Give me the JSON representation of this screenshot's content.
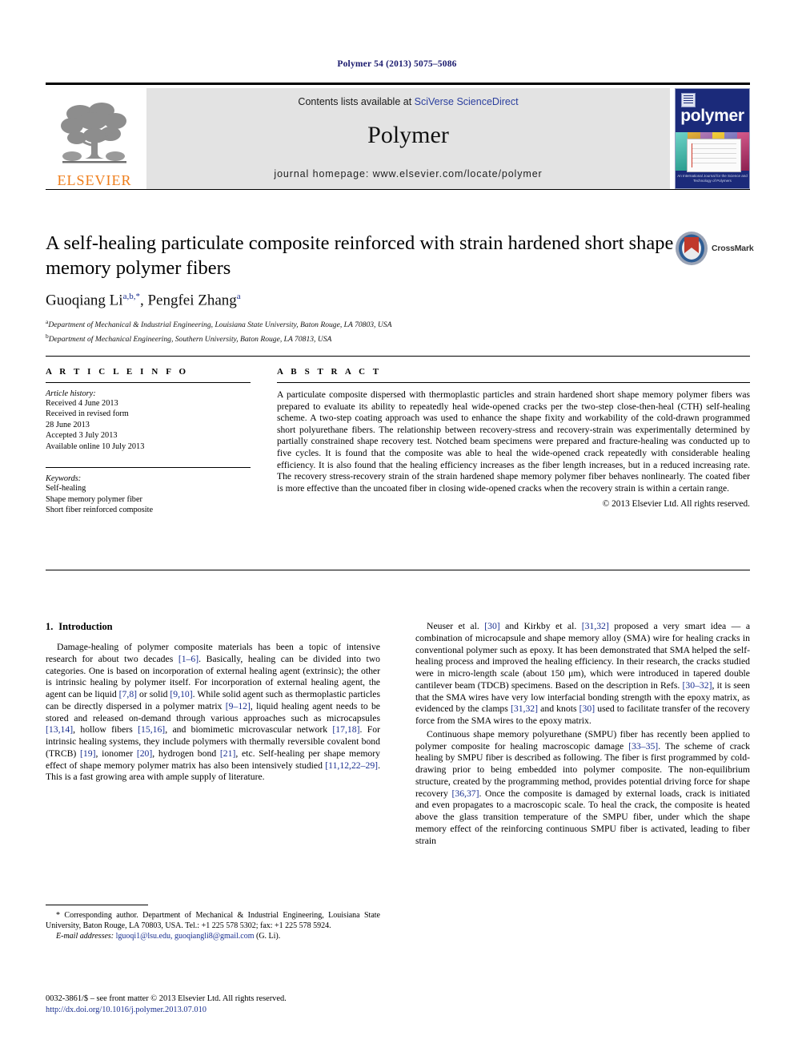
{
  "running_head": "Polymer 54 (2013) 5075–5086",
  "masthead": {
    "publisher_name": "ELSEVIER",
    "contents_prefix": "Contents lists available at ",
    "contents_link": "SciVerse ScienceDirect",
    "journal_name": "Polymer",
    "homepage": "journal homepage: www.elsevier.com/locate/polymer",
    "cover_title": "polymer",
    "cover_footer": "An International Journal for the\nScience and Technology of Polymers"
  },
  "article": {
    "title": "A self-healing particulate composite reinforced with strain hardened short shape memory polymer fibers",
    "crossmark_label": "CrossMark",
    "authors": "Guoqiang Li, Pengfei Zhang",
    "author_list": [
      {
        "name": "Guoqiang Li",
        "marks": "a,b,*"
      },
      {
        "name": "Pengfei Zhang",
        "marks": "a"
      }
    ],
    "affiliations": [
      {
        "mark": "a",
        "text": "Department of Mechanical & Industrial Engineering, Louisiana State University, Baton Rouge, LA 70803, USA"
      },
      {
        "mark": "b",
        "text": "Department of Mechanical Engineering, Southern University, Baton Rouge, LA 70813, USA"
      }
    ]
  },
  "article_info": {
    "heading": "A R T I C L E   I N F O",
    "history_label": "Article history:",
    "history": [
      "Received 4 June 2013",
      "Received in revised form",
      "28 June 2013",
      "Accepted 3 July 2013",
      "Available online 10 July 2013"
    ],
    "keywords_label": "Keywords:",
    "keywords": [
      "Self-healing",
      "Shape memory polymer fiber",
      "Short fiber reinforced composite"
    ]
  },
  "abstract": {
    "heading": "A B S T R A C T",
    "text": "A particulate composite dispersed with thermoplastic particles and strain hardened short shape memory polymer fibers was prepared to evaluate its ability to repeatedly heal wide-opened cracks per the two-step close-then-heal (CTH) self-healing scheme. A two-step coating approach was used to enhance the shape fixity and workability of the cold-drawn programmed short polyurethane fibers. The relationship between recovery-stress and recovery-strain was experimentally determined by partially constrained shape recovery test. Notched beam specimens were prepared and fracture-healing was conducted up to five cycles. It is found that the composite was able to heal the wide-opened crack repeatedly with considerable healing efficiency. It is also found that the healing efficiency increases as the fiber length increases, but in a reduced increasing rate. The recovery stress-recovery strain of the strain hardened shape memory polymer fiber behaves nonlinearly. The coated fiber is more effective than the uncoated fiber in closing wide-opened cracks when the recovery strain is within a certain range.",
    "copyright": "© 2013 Elsevier Ltd. All rights reserved."
  },
  "body": {
    "section_number": "1.",
    "section_title": "Introduction",
    "left_paragraphs": [
      "Damage-healing of polymer composite materials has been a topic of intensive research for about two decades [1–6]. Basically, healing can be divided into two categories. One is based on incorporation of external healing agent (extrinsic); the other is intrinsic healing by polymer itself. For incorporation of external healing agent, the agent can be liquid [7,8] or solid [9,10]. While solid agent such as thermoplastic particles can be directly dispersed in a polymer matrix [9–12], liquid healing agent needs to be stored and released on-demand through various approaches such as microcapsules [13,14], hollow fibers [15,16], and biomimetic microvascular network [17,18]. For intrinsic healing systems, they include polymers with thermally reversible covalent bond (TRCB) [19], ionomer [20], hydrogen bond [21], etc. Self-healing per shape memory effect of shape memory polymer matrix has also been intensively studied [11,12,22–29]. This is a fast growing area with ample supply of literature."
    ],
    "right_paragraphs": [
      "Neuser et al. [30] and Kirkby et al. [31,32] proposed a very smart idea — a combination of microcapsule and shape memory alloy (SMA) wire for healing cracks in conventional polymer such as epoxy. It has been demonstrated that SMA helped the self-healing process and improved the healing efficiency. In their research, the cracks studied were in micro-length scale (about 150 μm), which were introduced in tapered double cantilever beam (TDCB) specimens. Based on the description in Refs. [30–32], it is seen that the SMA wires have very low interfacial bonding strength with the epoxy matrix, as evidenced by the clamps [31,32] and knots [30] used to facilitate transfer of the recovery force from the SMA wires to the epoxy matrix.",
      "Continuous shape memory polyurethane (SMPU) fiber has recently been applied to polymer composite for healing macroscopic damage [33–35]. The scheme of crack healing by SMPU fiber is described as following. The fiber is first programmed by cold-drawing prior to being embedded into polymer composite. The non-equilibrium structure, created by the programming method, provides potential driving force for shape recovery [36,37]. Once the composite is damaged by external loads, crack is initiated and even propagates to a macroscopic scale. To heal the crack, the composite is heated above the glass transition temperature of the SMPU fiber, under which the shape memory effect of the reinforcing continuous SMPU fiber is activated, leading to fiber strain"
    ]
  },
  "footnotes": {
    "corresponding": "* Corresponding author. Department of Mechanical & Industrial Engineering, Louisiana State University, Baton Rouge, LA 70803, USA. Tel.: +1 225 578 5302; fax: +1 225 578 5924.",
    "email_label": "E-mail addresses:",
    "emails": "lguoqi1@lsu.edu, guoqiangli8@gmail.com",
    "email_suffix": "(G. Li).",
    "front_matter": "0032-3861/$ – see front matter © 2013 Elsevier Ltd. All rights reserved.",
    "doi": "http://dx.doi.org/10.1016/j.polymer.2013.07.010"
  },
  "colors": {
    "elsevier_orange": "#ef7d1a",
    "link_blue": "#1a2f8f",
    "cover_navy": "#1b2a7a",
    "band_grey": "#e3e3e3"
  }
}
